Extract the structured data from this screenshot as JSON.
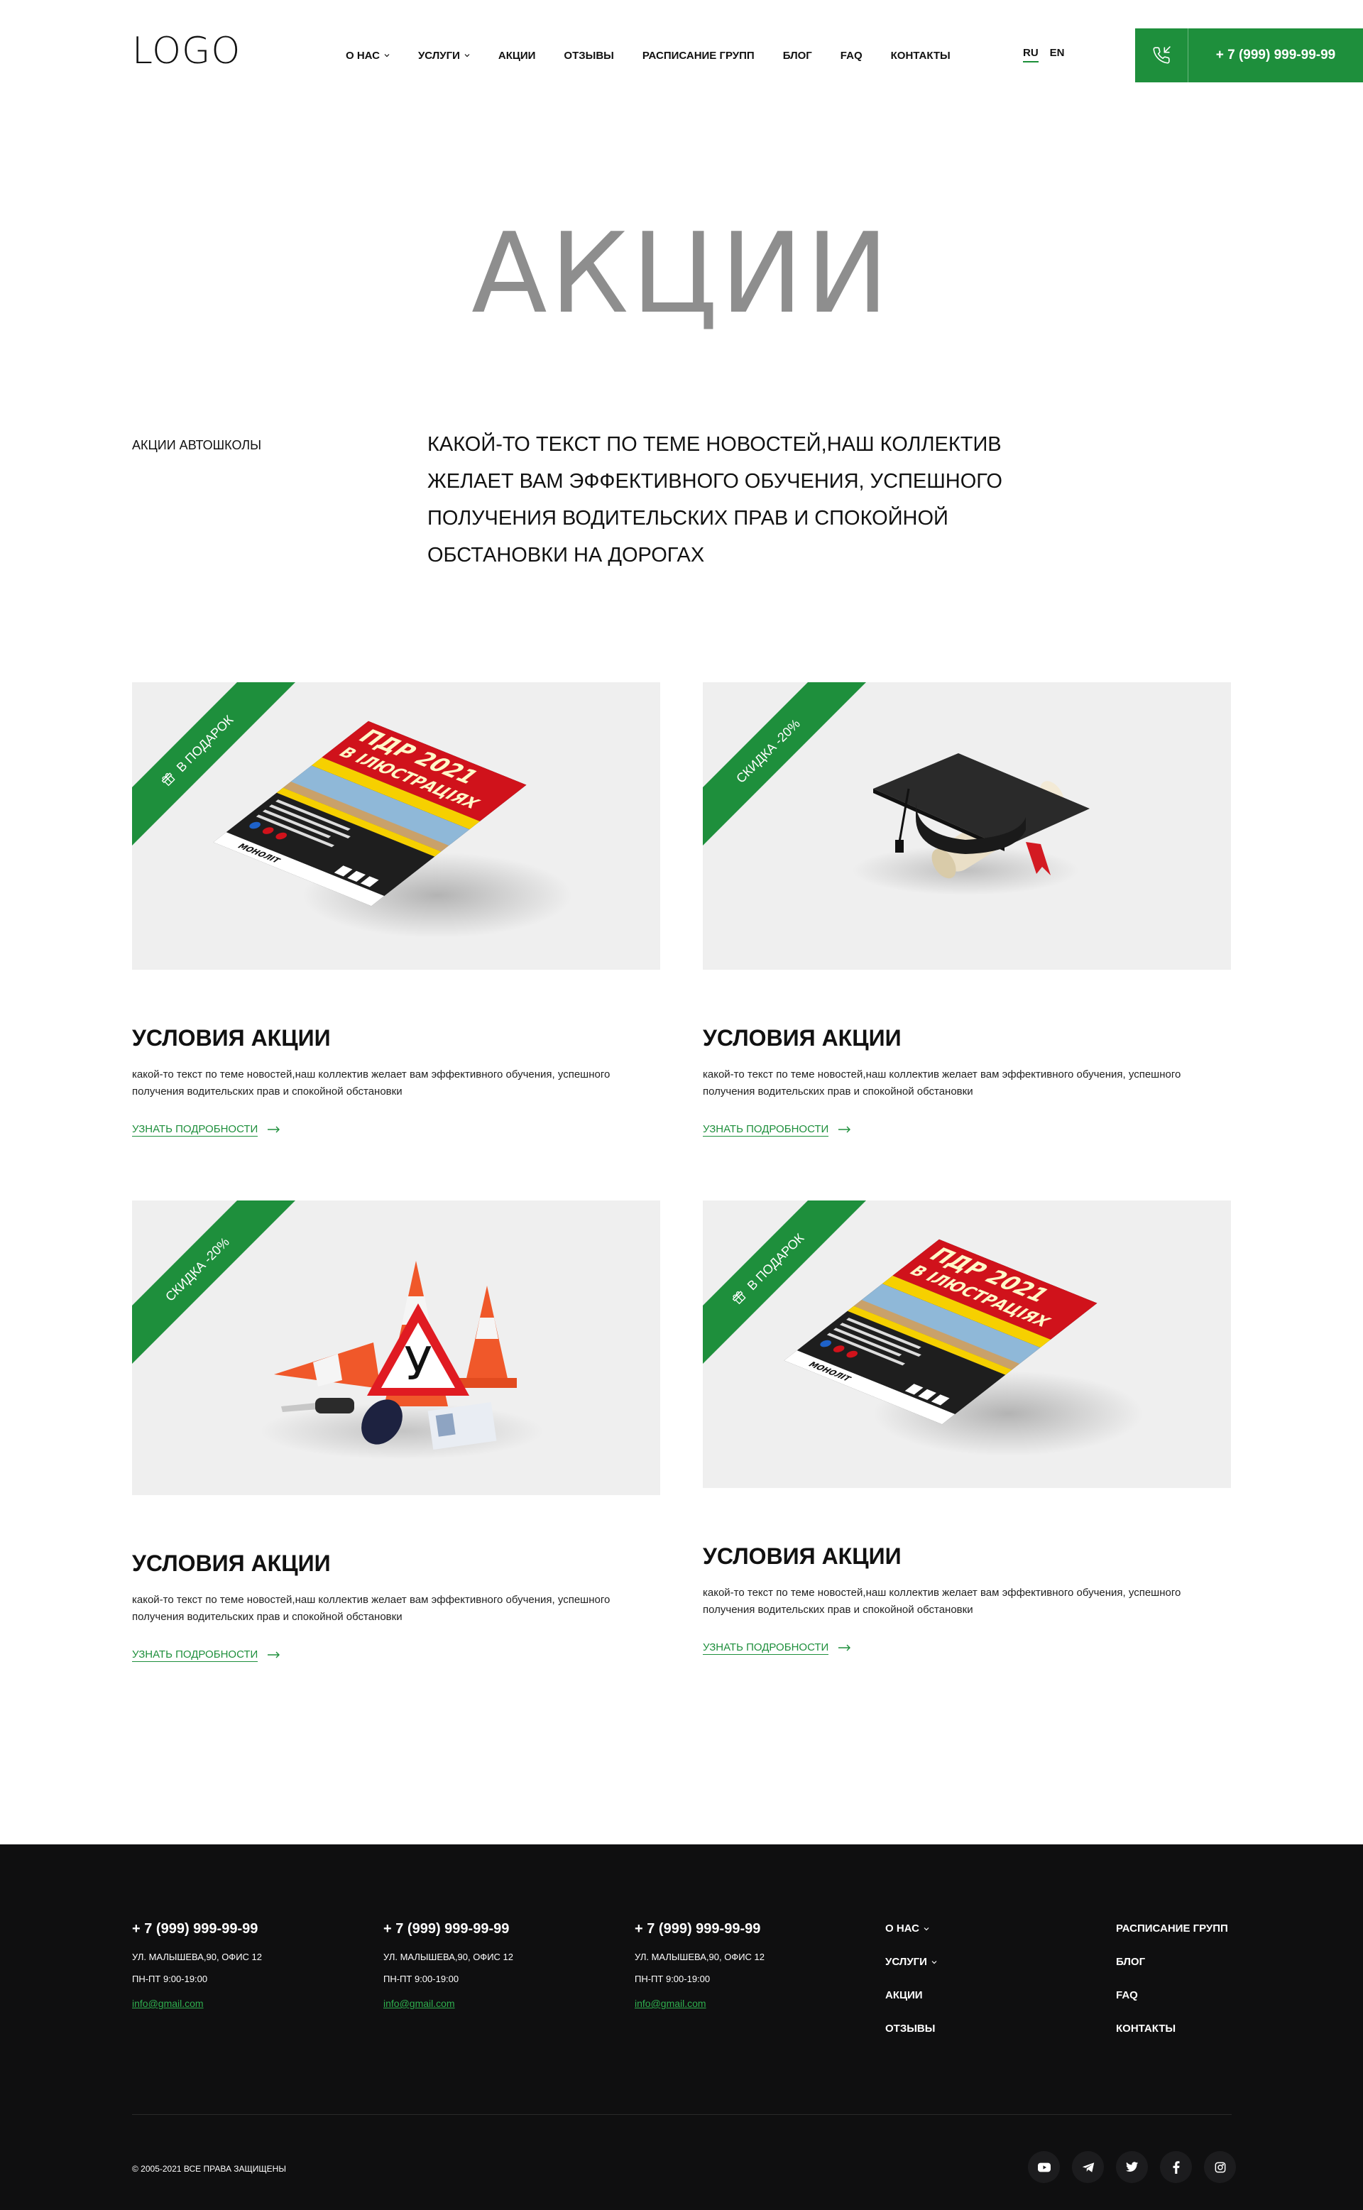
{
  "header": {
    "logo": "LOGO",
    "nav": [
      {
        "label": "О НАС",
        "has_dropdown": true
      },
      {
        "label": "УСЛУГИ",
        "has_dropdown": true
      },
      {
        "label": "АКЦИИ",
        "has_dropdown": false
      },
      {
        "label": "ОТЗЫВЫ",
        "has_dropdown": false
      },
      {
        "label": "РАСПИСАНИЕ ГРУПП",
        "has_dropdown": false
      },
      {
        "label": "БЛОГ",
        "has_dropdown": false
      },
      {
        "label": "FAQ",
        "has_dropdown": false
      },
      {
        "label": "КОНТАКТЫ",
        "has_dropdown": false
      }
    ],
    "languages": {
      "active": "RU",
      "other": "EN"
    },
    "phone": "+ 7 (999) 999-99-99",
    "phone_icon": "phone-incoming-icon"
  },
  "hero": {
    "title": "АКЦИИ",
    "label": "АКЦИИ АВТОШКОЛЫ",
    "text": "КАКОЙ-ТО ТЕКСТ ПО ТЕМЕ НОВОСТЕЙ,НАШ КОЛЛЕКТИВ ЖЕЛАЕТ ВАМ ЭФФЕКТИВНОГО ОБУЧЕНИЯ, УСПЕШНОГО ПОЛУЧЕНИЯ ВОДИТЕЛЬСКИХ ПРАВ И СПОКОЙНОЙ ОБСТАНОВКИ НА ДОРОГАХ"
  },
  "promos": [
    {
      "ribbon": "В ПОДАРОК",
      "ribbon_icon": "gift-icon",
      "image": "pdd-2021-book",
      "title": "УСЛОВИЯ АКЦИИ",
      "description": "какой-то текст по теме новостей,наш коллектив желает вам эффективного обучения, успешного получения водительских прав и спокойной обстановки",
      "link": "УЗНАТЬ ПОДРОБНОСТИ"
    },
    {
      "ribbon": "СКИДКА -20%",
      "ribbon_icon": "",
      "image": "graduation-cap-diploma",
      "title": "УСЛОВИЯ АКЦИИ",
      "description": "какой-то текст по теме новостей,наш коллектив желает вам эффективного обучения, успешного получения водительских прав и спокойной обстановки",
      "link": "УЗНАТЬ ПОДРОБНОСТИ"
    },
    {
      "ribbon": "СКИДКА -20%",
      "ribbon_icon": "",
      "image": "traffic-cones-student-sign",
      "title": "УСЛОВИЯ АКЦИИ",
      "description": "какой-то текст по теме новостей,наш коллектив желает вам эффективного обучения, успешного получения водительских прав и спокойной обстановки",
      "link": "УЗНАТЬ ПОДРОБНОСТИ"
    },
    {
      "ribbon": "В ПОДАРОК",
      "ribbon_icon": "gift-icon",
      "image": "pdd-2021-book",
      "title": "УСЛОВИЯ АКЦИИ",
      "description": "какой-то текст по теме новостей,наш коллектив желает вам эффективного обучения, успешного получения водительских прав и спокойной обстановки",
      "link": "УЗНАТЬ ПОДРОБНОСТИ"
    }
  ],
  "book_cover": {
    "line1": "ПДР 2021",
    "line2": "В ІЛЮСТРАЦІЯХ",
    "publisher": "МОНОЛІТ"
  },
  "cone_sign": "У",
  "footer": {
    "contacts": [
      {
        "phone": "+ 7 (999) 999-99-99",
        "address": "УЛ. МАЛЫШЕВА,90, ОФИС 12",
        "hours": "ПН-ПТ 9:00-19:00",
        "email": "info@gmail.com"
      },
      {
        "phone": "+ 7 (999) 999-99-99",
        "address": "УЛ. МАЛЫШЕВА,90, ОФИС 12",
        "hours": "ПН-ПТ 9:00-19:00",
        "email": "info@gmail.com"
      },
      {
        "phone": "+ 7 (999) 999-99-99",
        "address": "УЛ. МАЛЫШЕВА,90, ОФИС 12",
        "hours": "ПН-ПТ 9:00-19:00",
        "email": "info@gmail.com"
      }
    ],
    "nav_col1": [
      {
        "label": "О НАС",
        "has_dropdown": true
      },
      {
        "label": "УСЛУГИ",
        "has_dropdown": true
      },
      {
        "label": "АКЦИИ",
        "has_dropdown": false
      },
      {
        "label": "ОТЗЫВЫ",
        "has_dropdown": false
      }
    ],
    "nav_col2": [
      {
        "label": "РАСПИСАНИЕ ГРУПП"
      },
      {
        "label": "БЛОГ"
      },
      {
        "label": "FAQ"
      },
      {
        "label": "КОНТАКТЫ"
      }
    ],
    "copyright": "© 2005-2021 ВСЕ ПРАВА ЗАЩИЩЕНЫ",
    "socials": [
      "youtube-icon",
      "telegram-icon",
      "twitter-icon",
      "facebook-icon",
      "instagram-icon"
    ]
  },
  "colors": {
    "accent": "#1e8f3c",
    "footer_bg": "#0f0f10",
    "title_gray": "#8e8e8e",
    "card_bg": "#efefef"
  }
}
